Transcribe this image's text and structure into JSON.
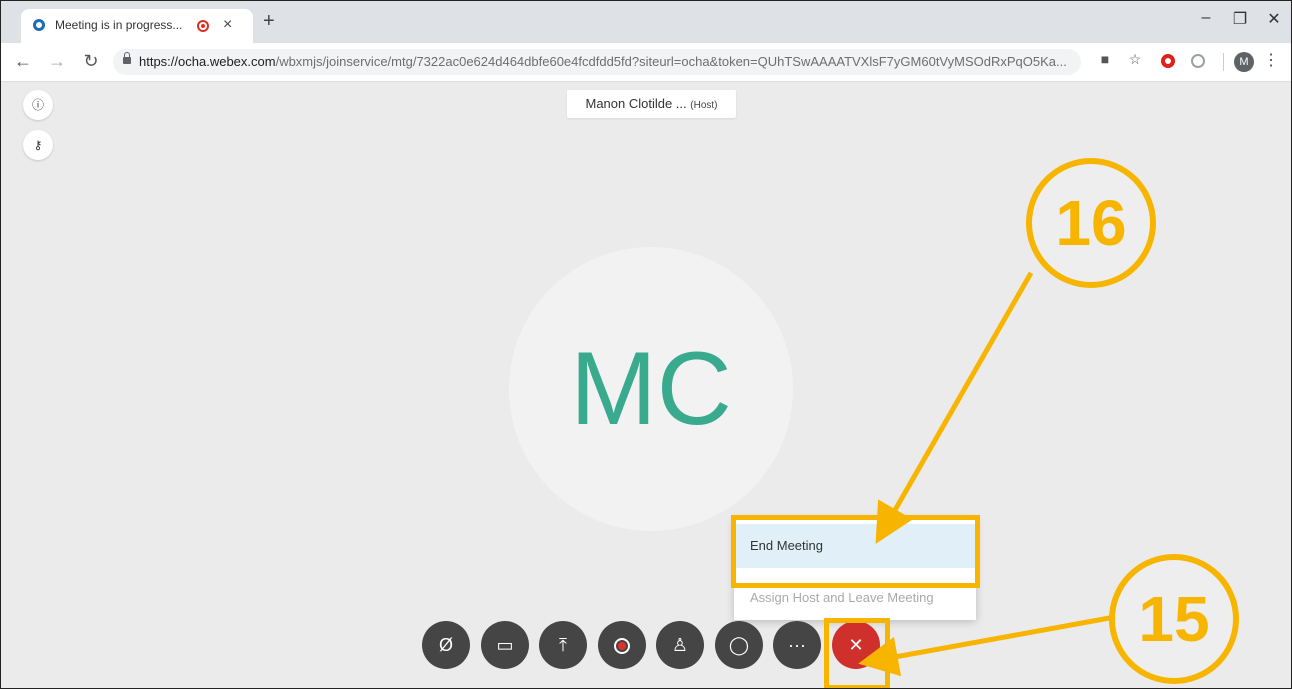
{
  "browser": {
    "tab_title": "Meeting is in progress...",
    "tab_close": "×",
    "new_tab": "+",
    "url_host": "https://ocha.webex.com",
    "url_path": "/wbxmjs/joinservice/mtg/7322ac0e624d464dbfe60e4fcdfdd5fd?siteurl=ocha&token=QUhTSwAAAATVXlsF7yGM60tVyMSOdRxPqO5Ka...",
    "profile_initial": "M",
    "window_controls": {
      "minimize": "–",
      "restore": "❐",
      "close": "✕"
    }
  },
  "meeting": {
    "host_name": "Manon Clotilde ...",
    "host_tag": "(Host)",
    "avatar_initials": "MC",
    "avatar_color": "#3aaa8f",
    "end_menu": {
      "items": [
        {
          "label": "End Meeting",
          "state": "highlighted"
        },
        {
          "label": "Assign Host and Leave Meeting",
          "state": "disabled"
        }
      ]
    },
    "controls": [
      {
        "name": "mute",
        "icon": "mic-off-icon",
        "glyph": "🎙"
      },
      {
        "name": "video",
        "icon": "video-icon",
        "glyph": "▭"
      },
      {
        "name": "share",
        "icon": "share-icon",
        "glyph": "⤒"
      },
      {
        "name": "record",
        "icon": "record-icon",
        "glyph": ""
      },
      {
        "name": "participants",
        "icon": "participants-icon",
        "glyph": "♙"
      },
      {
        "name": "chat",
        "icon": "chat-icon",
        "glyph": "◯"
      },
      {
        "name": "more",
        "icon": "more-icon",
        "glyph": "···"
      },
      {
        "name": "end",
        "icon": "close-icon",
        "glyph": "✕"
      }
    ],
    "end_button_color": "#d0302b"
  },
  "annotations": {
    "step_a": "16",
    "step_b": "15",
    "color": "#f7b500"
  }
}
